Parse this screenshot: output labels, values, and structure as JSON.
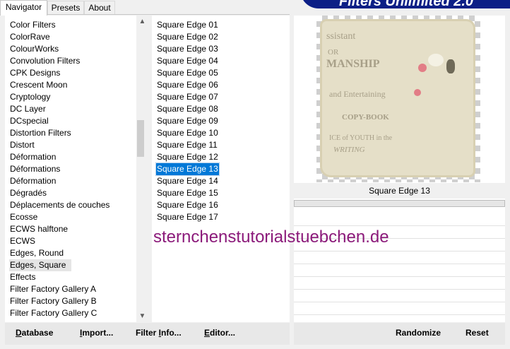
{
  "tabs": [
    {
      "label": "Navigator"
    },
    {
      "label": "Presets"
    },
    {
      "label": "About"
    }
  ],
  "brand": "Filters Unlimited 2.0",
  "filters": {
    "items": [
      "Color Filters",
      "ColorRave",
      "ColourWorks",
      "Convolution Filters",
      "CPK Designs",
      "Crescent Moon",
      "Cryptology",
      "DC Layer",
      "DCspecial",
      "Distortion Filters",
      "Distort",
      "Déformation",
      "Déformations",
      "Déformation",
      "Dégradés",
      "Déplacements de couches",
      "Ecosse",
      "ECWS halftone",
      "ECWS",
      "Edges, Round",
      "Edges, Square",
      "Effects",
      "Filter Factory Gallery A",
      "Filter Factory Gallery B",
      "Filter Factory Gallery C"
    ],
    "selected": "Edges, Square"
  },
  "effects": {
    "items": [
      "Square Edge 01",
      "Square Edge 02",
      "Square Edge 03",
      "Square Edge 04",
      "Square Edge 05",
      "Square Edge 06",
      "Square Edge 07",
      "Square Edge 08",
      "Square Edge 09",
      "Square Edge 10",
      "Square Edge 11",
      "Square Edge 12",
      "Square Edge 13",
      "Square Edge 14",
      "Square Edge 15",
      "Square Edge 16",
      "Square Edge 17"
    ],
    "selected": "Square Edge 13"
  },
  "preview": {
    "effect_name": "Square Edge 13",
    "sheet_lines": [
      "ssistant",
      "OR",
      "MANSHIP",
      "and Entertaining",
      "COPY-BOOK",
      "ICE of YOUTH in the",
      "WRITING"
    ]
  },
  "watermark": "sternchenstutorialstuebchen.de",
  "buttons": {
    "database": {
      "underlined": "D",
      "rest": "atabase"
    },
    "import": {
      "underlined": "I",
      "rest": "mport..."
    },
    "filter_info": {
      "before": "Filter ",
      "underlined": "I",
      "rest": "nfo..."
    },
    "editor": {
      "underlined": "E",
      "rest": "ditor..."
    },
    "randomize": "Randomize",
    "reset": "Reset"
  },
  "colors": {
    "selection": "#0078d7",
    "brand_bg": "#0c1f86",
    "watermark": "#8b1a7a"
  },
  "icons": {
    "scroll_up": "chevron-up-icon",
    "scroll_down": "chevron-down-icon"
  }
}
